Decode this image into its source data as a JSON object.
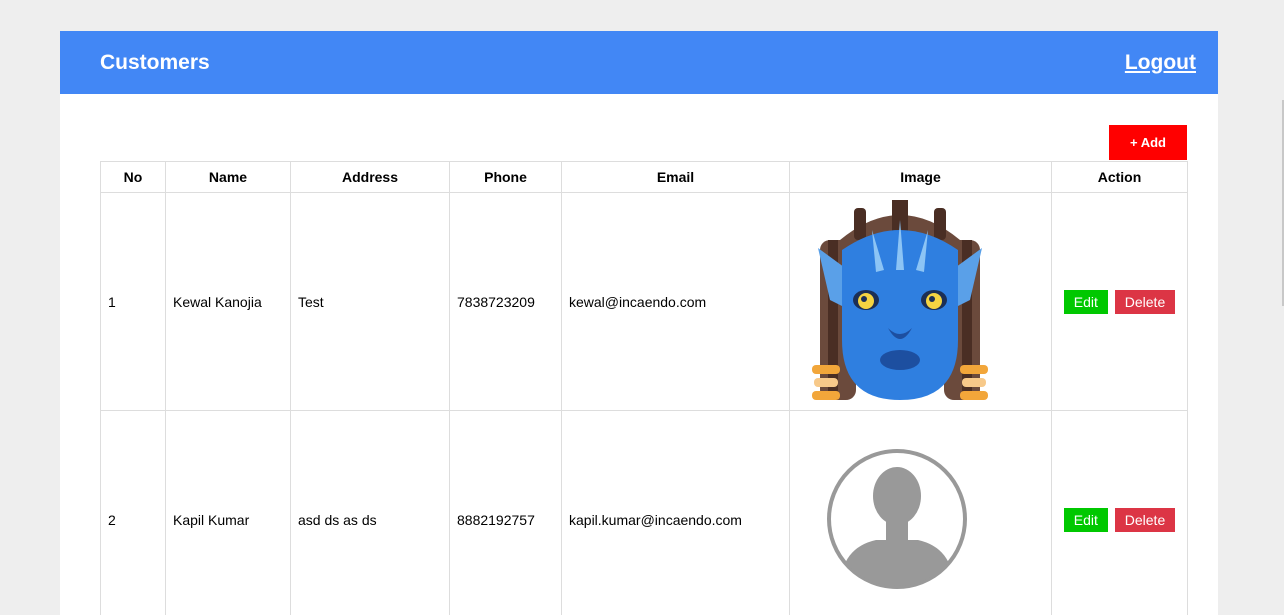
{
  "header": {
    "title": "Customers",
    "logout_label": "Logout"
  },
  "toolbar": {
    "add_label": "+ Add"
  },
  "table": {
    "columns": [
      "No",
      "Name",
      "Address",
      "Phone",
      "Email",
      "Image",
      "Action"
    ],
    "rows": [
      {
        "no": "1",
        "name": "Kewal Kanojia",
        "address": "Test",
        "phone": "7838723209",
        "email": "kewal@incaendo.com",
        "image": "avatar-character-icon"
      },
      {
        "no": "2",
        "name": "Kapil Kumar",
        "address": "asd ds as ds",
        "phone": "8882192757",
        "email": "kapil.kumar@incaendo.com",
        "image": "default-user-icon"
      }
    ],
    "actions": {
      "edit_label": "Edit",
      "delete_label": "Delete"
    }
  },
  "colors": {
    "header_bg": "#4287f5",
    "add_button": "#ff0000",
    "edit_button": "#00c800",
    "delete_button": "#dc3545",
    "page_bg": "#eeeeee"
  }
}
